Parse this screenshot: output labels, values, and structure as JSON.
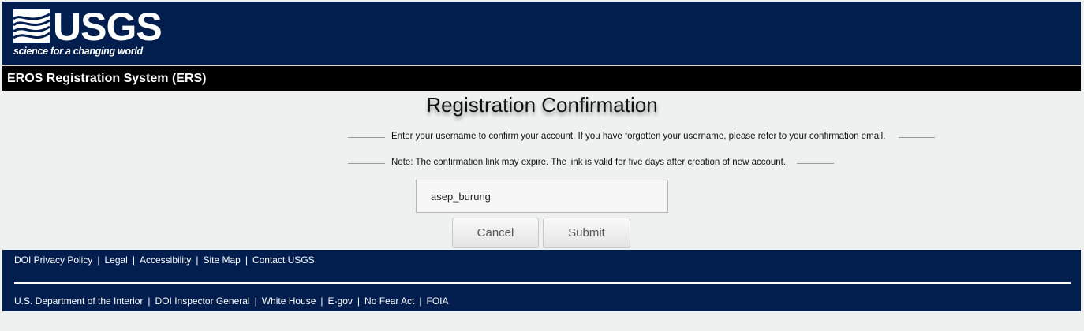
{
  "header": {
    "logo_text": "USGS",
    "logo_tagline": "science for a changing world",
    "system_name": "EROS Registration System (ERS)"
  },
  "main": {
    "title": "Registration Confirmation",
    "instruction": "Enter your username to confirm your account. If you have forgotten your username, please refer to your confirmation email.",
    "note": "Note: The confirmation link may expire. The link is valid for five days after creation of new account.",
    "username_value": "asep_burung",
    "cancel_label": "Cancel",
    "submit_label": "Submit"
  },
  "footer": {
    "row1": [
      "DOI Privacy Policy",
      "Legal",
      "Accessibility",
      "Site Map",
      "Contact USGS"
    ],
    "row2": [
      "U.S. Department of the Interior",
      "DOI Inspector General",
      "White House",
      "E-gov",
      "No Fear Act",
      "FOIA"
    ],
    "separator": "|"
  },
  "colors": {
    "header_bg": "#011e4f",
    "ers_bar_bg": "#000000",
    "page_bg": "#eef1f0"
  }
}
